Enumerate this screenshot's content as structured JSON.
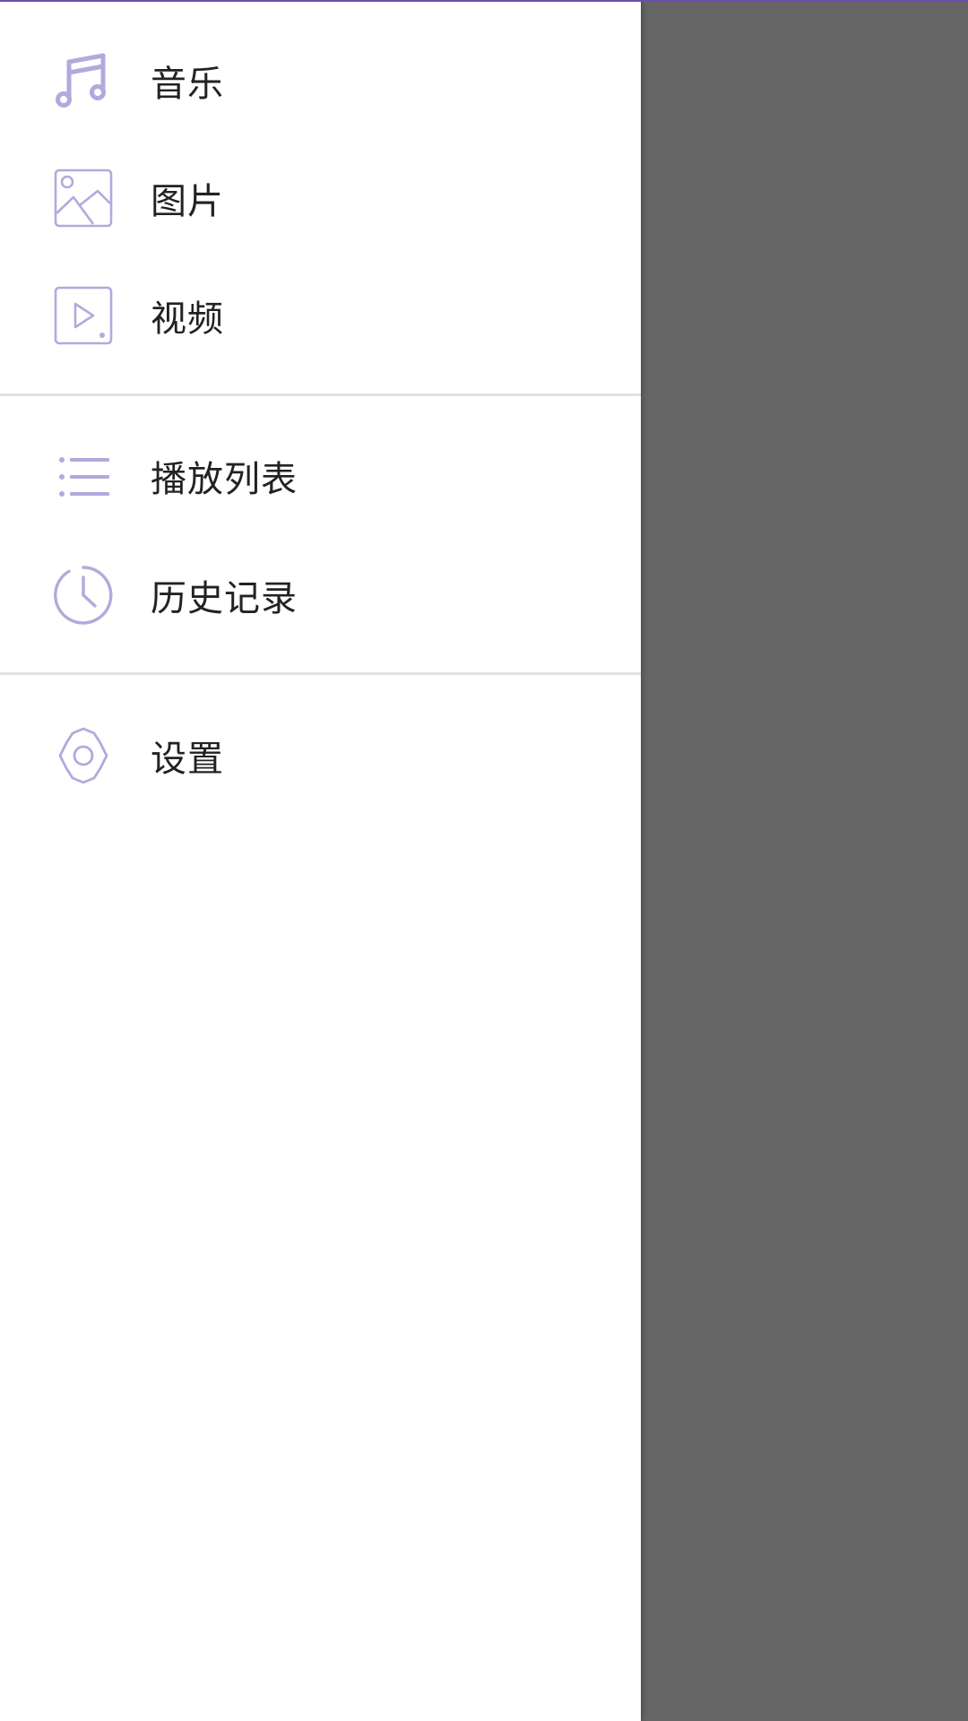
{
  "accent_color": "#b3a9dc",
  "top_bar_color": "#6a4fa8",
  "scrim_color": "#666666",
  "drawer": {
    "items": [
      {
        "label": "音乐",
        "icon": "music-note-icon"
      },
      {
        "label": "图片",
        "icon": "image-icon"
      },
      {
        "label": "视频",
        "icon": "video-play-icon"
      },
      {
        "label": "播放列表",
        "icon": "list-icon"
      },
      {
        "label": "历史记录",
        "icon": "clock-icon"
      },
      {
        "label": "设置",
        "icon": "gear-icon"
      }
    ]
  }
}
